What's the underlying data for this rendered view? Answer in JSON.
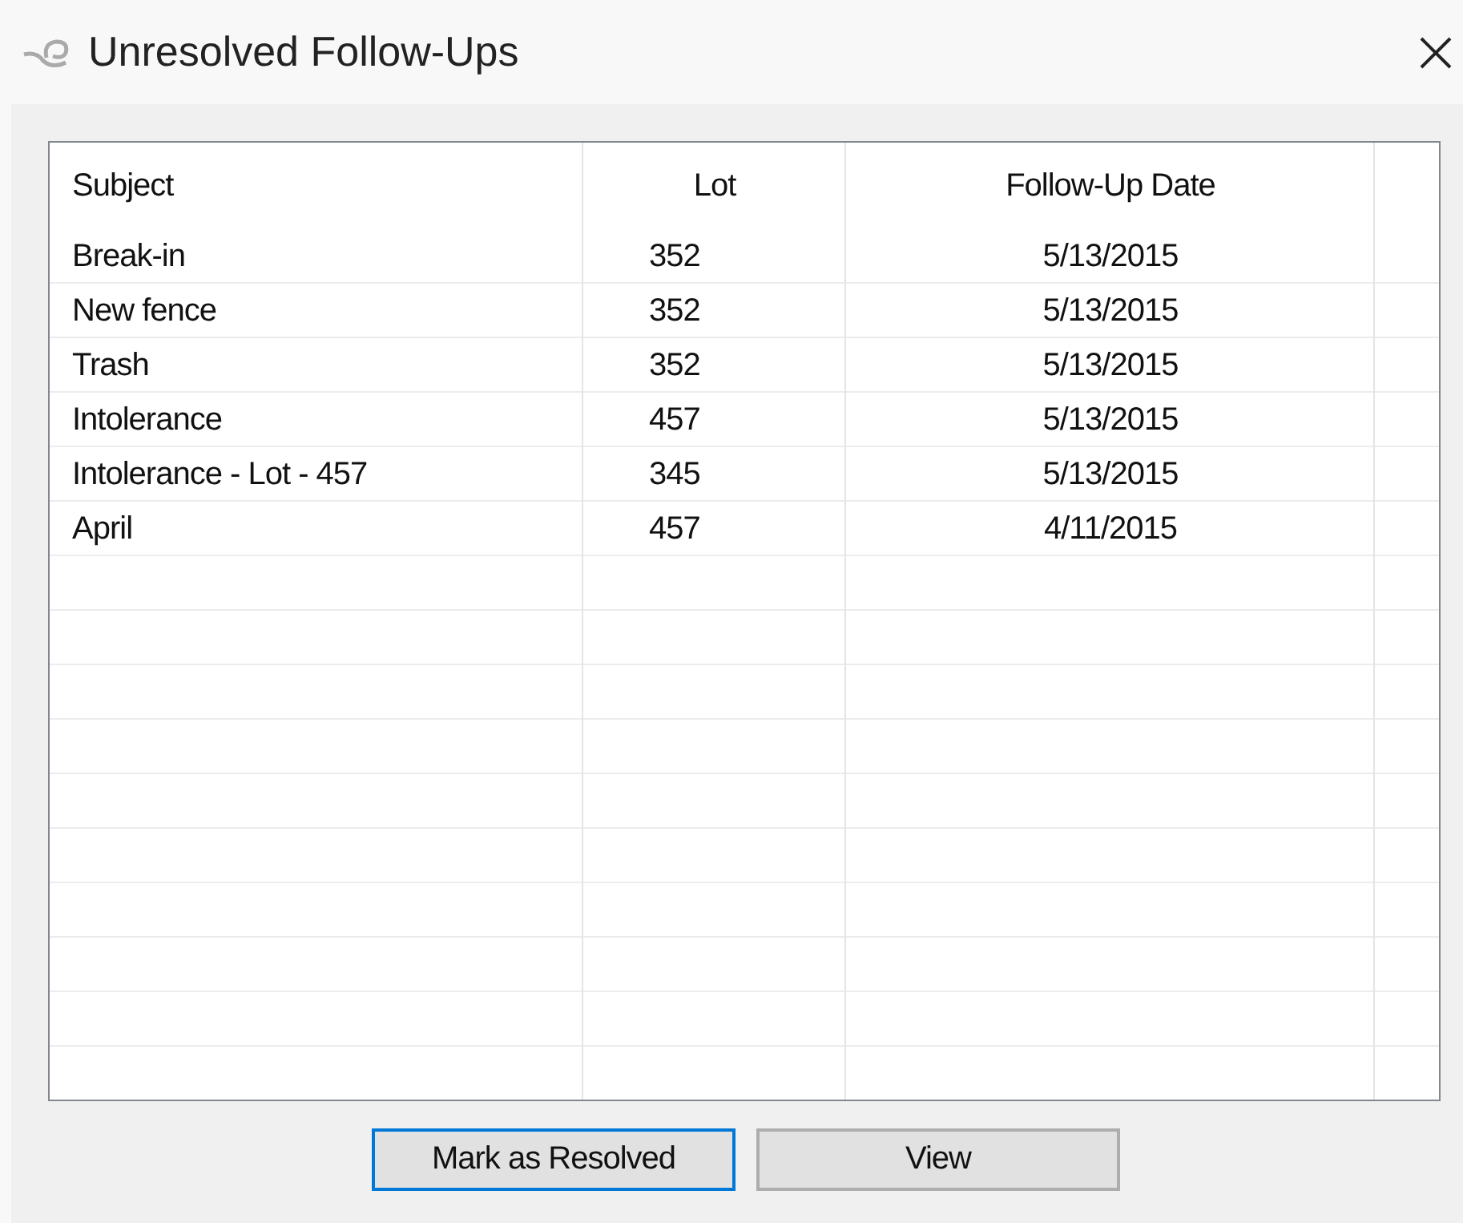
{
  "window": {
    "title": "Unresolved Follow-Ups"
  },
  "table": {
    "columns": [
      "Subject",
      "Lot",
      "Follow-Up Date"
    ],
    "rows": [
      [
        "Break-in",
        "352",
        "5/13/2015"
      ],
      [
        "New fence",
        "352",
        "5/13/2015"
      ],
      [
        "Trash",
        "352",
        "5/13/2015"
      ],
      [
        "Intolerance",
        "457",
        "5/13/2015"
      ],
      [
        "Intolerance - Lot - 457",
        "345",
        "5/13/2015"
      ],
      [
        "April",
        "457",
        "4/11/2015"
      ]
    ]
  },
  "buttons": [
    {
      "label": "Mark as Resolved",
      "focused": true
    },
    {
      "label": "View",
      "focused": false
    }
  ]
}
